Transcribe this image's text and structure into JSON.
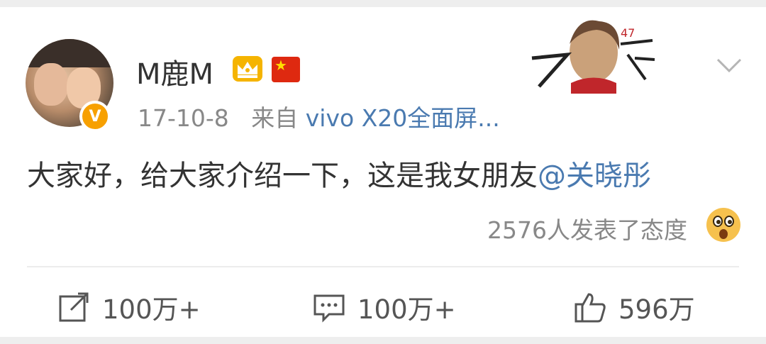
{
  "post": {
    "username": "M鹿M",
    "date": "17-10-8",
    "source_prefix": "来自",
    "source_device": "vivo X20全面屏...",
    "text": "大家好，给大家介绍一下，这是我女朋友",
    "mention": "@关晓彤",
    "reactions_count_text": "2576人发表了态度",
    "verified_badge": "V"
  },
  "actions": {
    "repost": "100万+",
    "comment": "100万+",
    "like": "596万"
  },
  "icons": {
    "verified": "verified-v-icon",
    "crown": "crown-icon",
    "flag": "china-flag-icon",
    "chevron": "chevron-down-icon",
    "reaction": "surprised-face-icon",
    "repost": "share-icon",
    "comment": "comment-icon",
    "like": "thumbs-up-icon"
  },
  "colors": {
    "link": "#4a7ab0",
    "meta": "#888888",
    "badge": "#f7a000"
  }
}
